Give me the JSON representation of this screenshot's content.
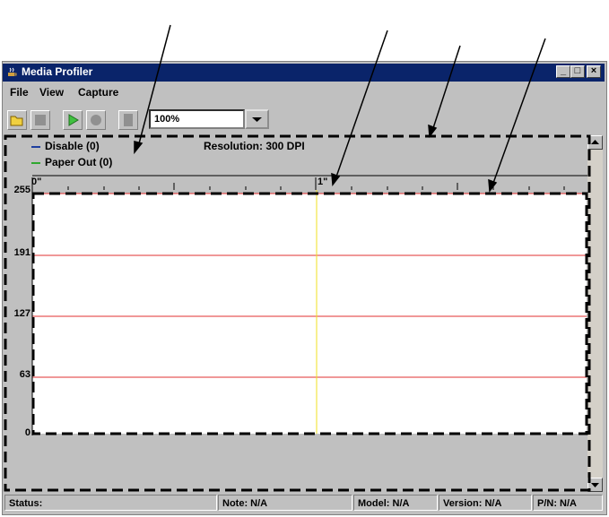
{
  "window": {
    "title": "Media Profiler",
    "app_icon": "java-cup-icon",
    "controls": [
      "minimize-icon",
      "maximize-icon",
      "close-icon"
    ]
  },
  "menu": {
    "items": [
      "File",
      "View",
      "Capture"
    ]
  },
  "toolbar": {
    "zoom_value": "100%"
  },
  "legend": {
    "disable": "Disable (0)",
    "paper_out": "Paper Out (0)",
    "disable_color": "#1f3f9f",
    "paper_out_color": "#2fa82f"
  },
  "resolution": "Resolution: 300 DPI",
  "ruler": {
    "label_0": "0\"",
    "label_1": "1\""
  },
  "y_axis": {
    "labels": [
      "255",
      "191",
      "127",
      "63",
      "0"
    ]
  },
  "colors": {
    "grid_line": "#e03030",
    "cursor_line": "#f0e020",
    "title_bar": "#0a246a"
  },
  "status": {
    "status": "Status:",
    "note": "Note: N/A",
    "model": "Model: N/A",
    "version": "Version: N/A",
    "pn": "P/N: N/A"
  }
}
